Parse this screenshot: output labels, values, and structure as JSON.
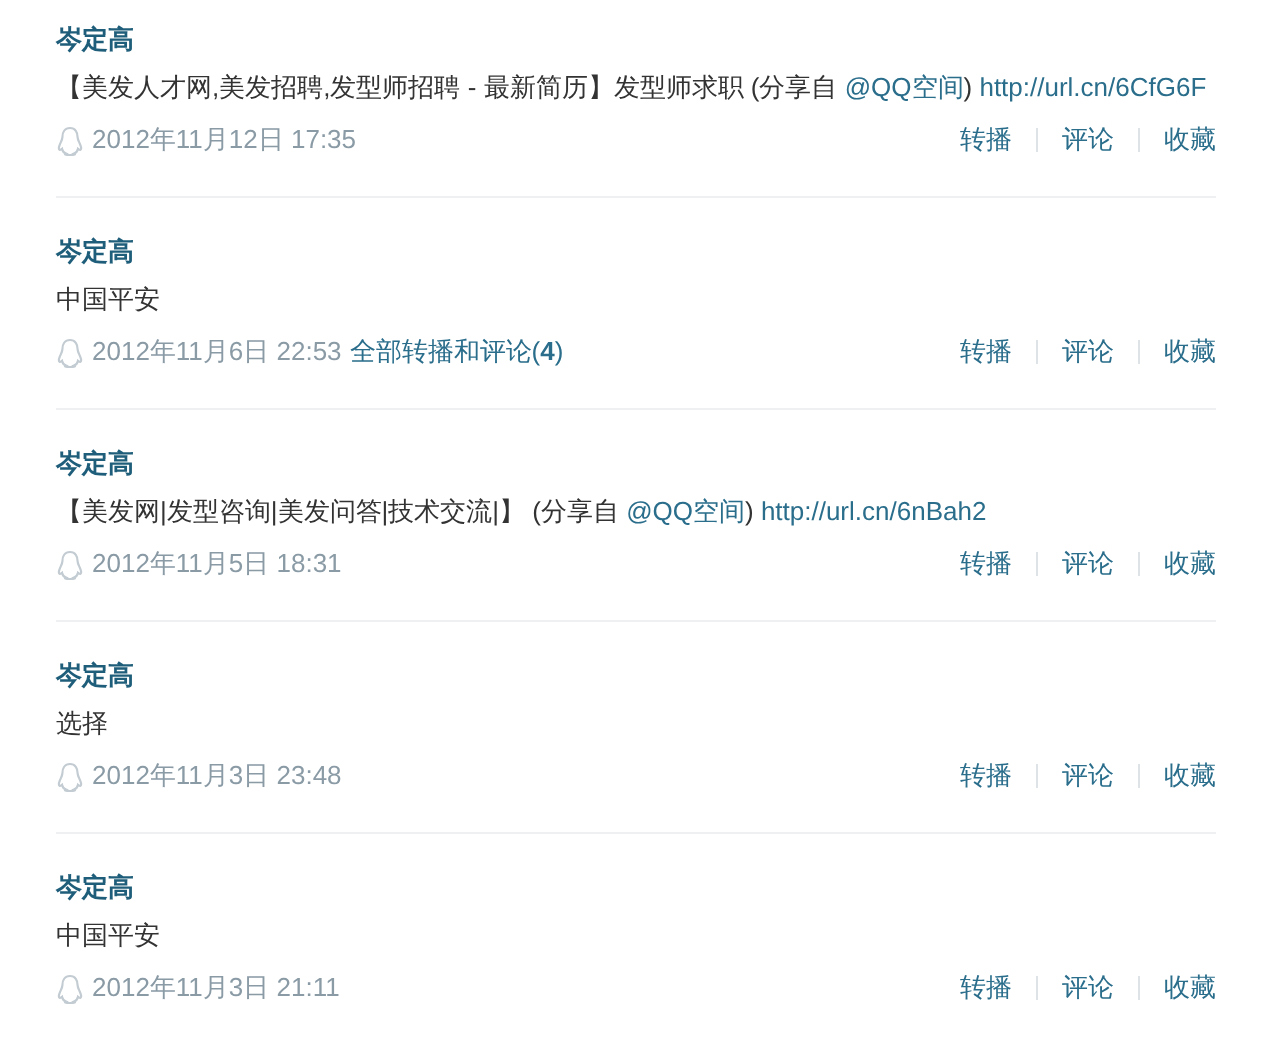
{
  "posts": [
    {
      "author": "岑定高",
      "content": [
        {
          "kind": "text",
          "text": "【美发人才网,美发招聘,发型师招聘 - 最新简历】发型师求职 (分享自 "
        },
        {
          "kind": "link",
          "text": "@QQ空间"
        },
        {
          "kind": "text",
          "text": ") "
        },
        {
          "kind": "link",
          "text": "http://url.cn/6CfG6F"
        }
      ],
      "time": "2012年11月12日 17:35",
      "actions": [
        "转播",
        "评论",
        "收藏"
      ]
    },
    {
      "author": "岑定高",
      "content": [
        {
          "kind": "text",
          "text": "中国平安"
        }
      ],
      "time": "2012年11月6日 22:53",
      "comments_link": "全部转播和评论(**4**)",
      "actions": [
        "转播",
        "评论",
        "收藏"
      ]
    },
    {
      "author": "岑定高",
      "content": [
        {
          "kind": "text",
          "text": "【美发网|发型咨询|美发问答|技术交流|】 (分享自 "
        },
        {
          "kind": "link",
          "text": "@QQ空间"
        },
        {
          "kind": "text",
          "text": ") "
        },
        {
          "kind": "link",
          "text": "http://url.cn/6nBah2"
        }
      ],
      "time": "2012年11月5日 18:31",
      "actions": [
        "转播",
        "评论",
        "收藏"
      ]
    },
    {
      "author": "岑定高",
      "content": [
        {
          "kind": "text",
          "text": "选择"
        }
      ],
      "time": "2012年11月3日 23:48",
      "actions": [
        "转播",
        "评论",
        "收藏"
      ]
    },
    {
      "author": "岑定高",
      "content": [
        {
          "kind": "text",
          "text": "中国平安"
        }
      ],
      "time": "2012年11月3日 21:11",
      "actions": [
        "转播",
        "评论",
        "收藏"
      ]
    }
  ]
}
